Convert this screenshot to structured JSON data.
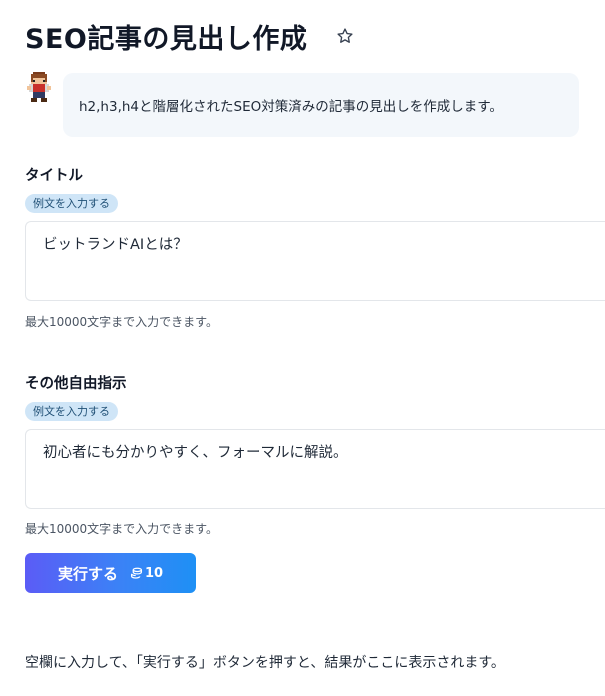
{
  "header": {
    "title": "SEO記事の見出し作成",
    "favorite_icon": "star-outline-icon"
  },
  "intro": {
    "avatar_icon": "pixel-character-icon",
    "message": "h2,h3,h4と階層化されたSEO対策済みの記事の見出しを作成します。"
  },
  "form": {
    "title_field": {
      "label": "タイトル",
      "example_chip": "例文を入力する",
      "value": "ビットランドAIとは？",
      "note": "最大10000文字まで入力できます。"
    },
    "instructions_field": {
      "label": "その他自由指示",
      "example_chip": "例文を入力する",
      "value": "初心者にも分かりやすく、フォーマルに解説。",
      "note": "最大10000文字まで入力できます。"
    },
    "run_button": {
      "label": "実行する",
      "credit_icon": "coin-stack-icon",
      "credit_cost": "10"
    }
  },
  "result": {
    "placeholder": "空欄に入力して、「実行する」ボタンを押すと、結果がここに表示されます。"
  },
  "colors": {
    "bubble_bg": "#f3f7fb",
    "chip_bg": "#cfe5f7",
    "button_gradient_start": "#5b5cf6",
    "button_gradient_end": "#1e90f5"
  }
}
